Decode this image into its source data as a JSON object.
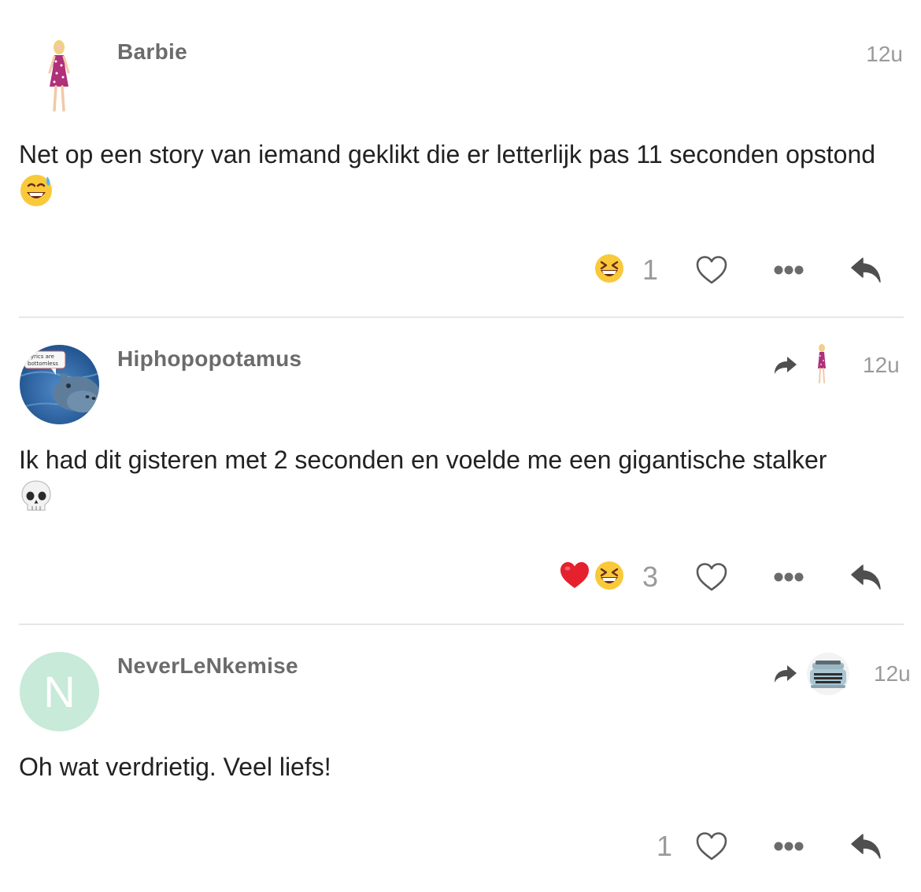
{
  "comments": [
    {
      "username": "Barbie",
      "time": "12u",
      "text": "Net op een story van iemand geklikt die er letterlijk pas 11 seconden opstond",
      "text_emoji": "sweat-smile-emoji",
      "avatar": "barbie-doll-avatar",
      "reaction_emojis": [
        "laughing-emoji"
      ],
      "reaction_count": "1",
      "like_icon": "heart-outline-icon",
      "more_icon": "more-dots-icon",
      "reply_icon": "reply-arrow-icon"
    },
    {
      "username": "Hiphopopotamus",
      "time": "12u",
      "text": "Ik had dit gisteren met 2 seconden en voelde me een gigantische stalker",
      "text_emoji": "skull-emoji",
      "avatar": "hippo-avatar",
      "avatar_caption": "lyrics are bottomless",
      "quoted_avatar": "barbie-doll-avatar",
      "reaction_emojis": [
        "red-heart-emoji",
        "laughing-emoji"
      ],
      "reaction_count": "3",
      "like_icon": "heart-outline-icon",
      "more_icon": "more-dots-icon",
      "reply_icon": "reply-arrow-icon"
    },
    {
      "username": "NeverLeNkemise",
      "time": "12u",
      "text": "Oh wat verdrietig. Veel liefs!",
      "avatar_letter": "N",
      "quoted_avatar": "typewriter-avatar",
      "reaction_count": "1",
      "like_icon": "heart-outline-icon",
      "more_icon": "more-dots-icon",
      "reply_icon": "reply-arrow-icon"
    }
  ],
  "colors": {
    "username": "#6b6b6b",
    "time": "#9a9a9a",
    "body_text": "#222222",
    "divider": "#e6e6e6",
    "icon": "#5a5a5a",
    "letter_avatar_bg": "#c8ead8"
  }
}
